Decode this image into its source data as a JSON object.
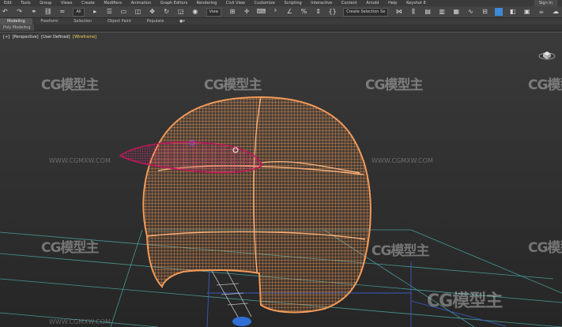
{
  "menu": {
    "items": [
      "Edit",
      "Tools",
      "Group",
      "Views",
      "Create",
      "Modifiers",
      "Animation",
      "Graph Editors",
      "Rendering",
      "Civil View",
      "Customize",
      "Scripting",
      "Interactive",
      "Content",
      "Arnold",
      "Help",
      "Keyshot 8"
    ],
    "signin": "Sign In"
  },
  "toolbar": {
    "all_filter": "All",
    "view_select": "View",
    "selection_set": "Create Selection Se"
  },
  "ribbon": {
    "tabs": [
      "Modeling",
      "Freeform",
      "Selection",
      "Object Paint",
      "Populate"
    ],
    "active": "Modeling",
    "panel": "Poly Modeling"
  },
  "viewport": {
    "label_plus": "[+]",
    "label_view": "[Perspective]",
    "label_shading": "[User Defined]",
    "label_mode": "[Wireframe]"
  },
  "watermark": {
    "logo": "CG模型主",
    "url": "WWW.CGMXW.COM"
  },
  "colors": {
    "helmet_wire": "#f29a58",
    "visor_wire": "#c0185a",
    "grid_lines": "#4fb2b0",
    "stand": "#2f6fd6"
  }
}
